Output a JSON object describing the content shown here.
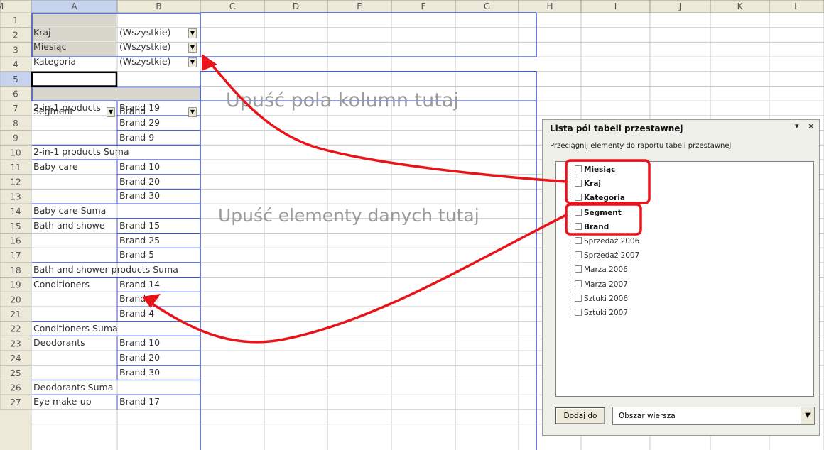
{
  "columns": [
    "A",
    "B",
    "C",
    "D",
    "E",
    "F",
    "G",
    "H",
    "I",
    "J",
    "K",
    "L",
    "M"
  ],
  "rows": [
    "1",
    "2",
    "3",
    "4",
    "5",
    "6",
    "7",
    "8",
    "9",
    "10",
    "11",
    "12",
    "13",
    "14",
    "15",
    "16",
    "17",
    "18",
    "19",
    "20",
    "21",
    "22",
    "23",
    "24",
    "25",
    "26",
    "27"
  ],
  "page_filters": [
    {
      "field": "Kraj",
      "value": "(Wszystkie)"
    },
    {
      "field": "Miesiąc",
      "value": "(Wszystkie)"
    },
    {
      "field": "Kategoria",
      "value": "(Wszystkie)"
    }
  ],
  "row_headers": {
    "segment": "Segment",
    "brand": "Brand"
  },
  "pivot_rows": [
    {
      "row": 7,
      "a": "2-in-1 products",
      "b": "Brand 19"
    },
    {
      "row": 8,
      "a": "",
      "b": "Brand 29"
    },
    {
      "row": 9,
      "a": "",
      "b": "Brand 9"
    },
    {
      "row": 10,
      "a": "2-in-1 products Suma",
      "b": ""
    },
    {
      "row": 11,
      "a": "Baby care",
      "b": "Brand 10"
    },
    {
      "row": 12,
      "a": "",
      "b": "Brand 20"
    },
    {
      "row": 13,
      "a": "",
      "b": "Brand 30"
    },
    {
      "row": 14,
      "a": "Baby care Suma",
      "b": ""
    },
    {
      "row": 15,
      "a": "Bath and showe",
      "b": "Brand 15"
    },
    {
      "row": 16,
      "a": "",
      "b": "Brand 25"
    },
    {
      "row": 17,
      "a": "",
      "b": "Brand 5"
    },
    {
      "row": 18,
      "a": "Bath and shower products Suma",
      "b": ""
    },
    {
      "row": 19,
      "a": "Conditioners",
      "b": "Brand 14"
    },
    {
      "row": 20,
      "a": "",
      "b": "Brand 24"
    },
    {
      "row": 21,
      "a": "",
      "b": "Brand 4"
    },
    {
      "row": 22,
      "a": "Conditioners Suma",
      "b": ""
    },
    {
      "row": 23,
      "a": "Deodorants",
      "b": "Brand 10"
    },
    {
      "row": 24,
      "a": "",
      "b": "Brand 20"
    },
    {
      "row": 25,
      "a": "",
      "b": "Brand 30"
    },
    {
      "row": 26,
      "a": "Deodorants Suma",
      "b": ""
    },
    {
      "row": 27,
      "a": "Eye make-up",
      "b": "Brand 17"
    }
  ],
  "drop_zones": {
    "columns": "Upuść pola kolumn tutaj",
    "data": "Upuść elementy danych tutaj"
  },
  "field_list_pane": {
    "title": "Lista pól tabeli przestawnej",
    "instruction": "Przeciągnij elementy do raportu tabeli przestawnej",
    "fields": [
      {
        "label": "Miesiąc",
        "used": true
      },
      {
        "label": "Kraj",
        "used": true
      },
      {
        "label": "Kategoria",
        "used": true
      },
      {
        "label": "Segment",
        "used": true
      },
      {
        "label": "Brand",
        "used": true
      },
      {
        "label": "Sprzedaż 2006",
        "used": false
      },
      {
        "label": "Sprzedaż 2007",
        "used": false
      },
      {
        "label": "Marża 2006",
        "used": false
      },
      {
        "label": "Marża 2007",
        "used": false
      },
      {
        "label": "Sztuki 2006",
        "used": false
      },
      {
        "label": "Sztuki 2007",
        "used": false
      }
    ],
    "add_button": "Dodaj do",
    "area_select": "Obszar wiersza"
  },
  "colors": {
    "annotation": "#e8141a",
    "pivot_border": "#3d52c8",
    "header_bg": "#ece9d8",
    "selected_header_bg": "#c5d3ee",
    "grid": "#c8c8c8",
    "drop_text": "#9a9a9a"
  }
}
